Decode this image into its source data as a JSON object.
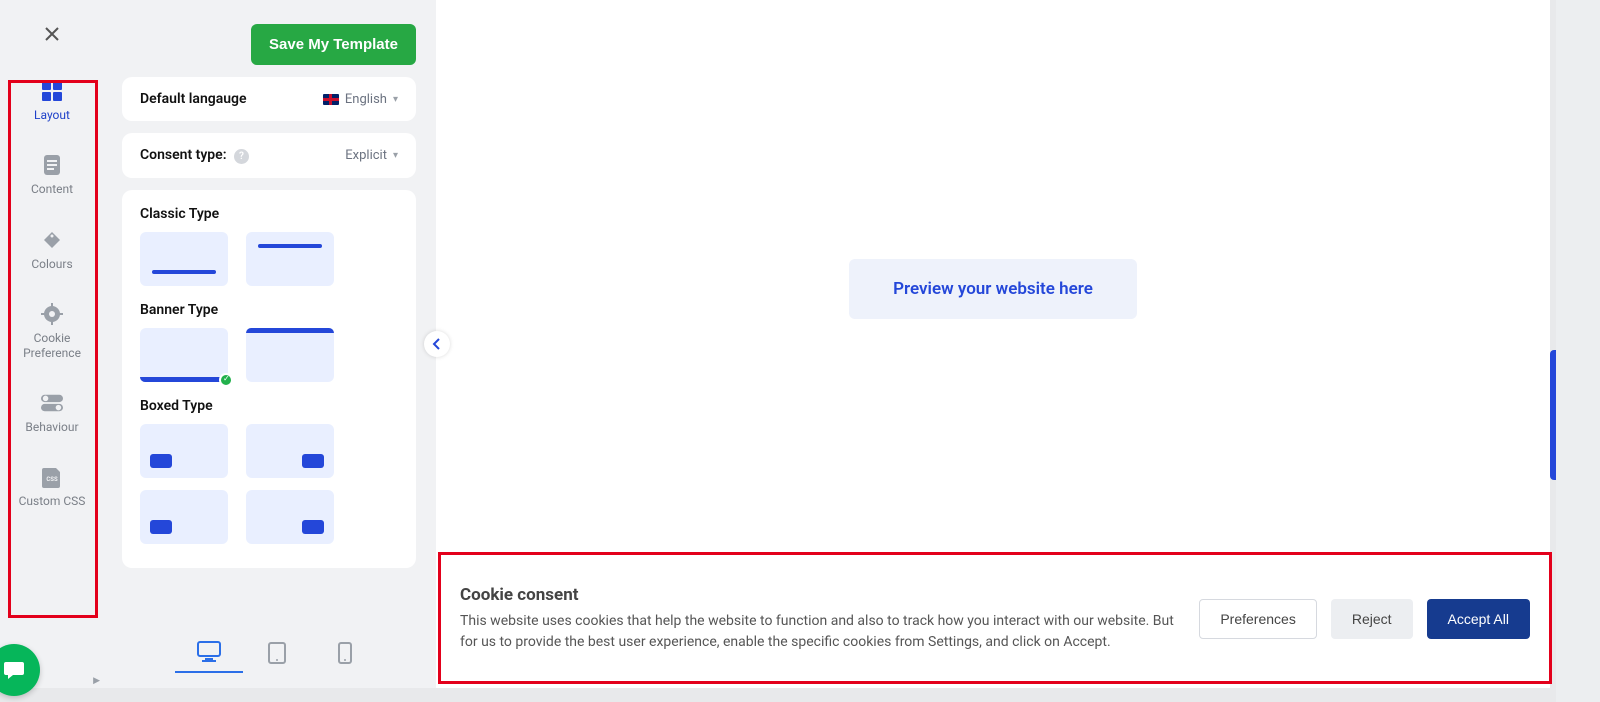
{
  "sidebar": {
    "items": [
      {
        "label": "Layout"
      },
      {
        "label": "Content"
      },
      {
        "label": "Colours"
      },
      {
        "label": "Cookie Preference"
      },
      {
        "label": "Behaviour"
      },
      {
        "label": "Custom CSS"
      }
    ]
  },
  "header": {
    "save_button": "Save My Template"
  },
  "settings": {
    "language_label": "Default langauge",
    "language_value": "English",
    "consent_type_label": "Consent type:",
    "consent_type_value": "Explicit"
  },
  "layout_types": {
    "classic_label": "Classic Type",
    "banner_label": "Banner Type",
    "boxed_label": "Boxed Type"
  },
  "preview": {
    "button_label": "Preview your website here"
  },
  "cookie_banner": {
    "title": "Cookie consent",
    "description": "This website uses cookies that help the website to function and also to track how you interact with our website. But for us to provide the best user experience, enable the specific cookies from Settings, and click on Accept.",
    "preferences": "Preferences",
    "reject": "Reject",
    "accept": "Accept All"
  }
}
